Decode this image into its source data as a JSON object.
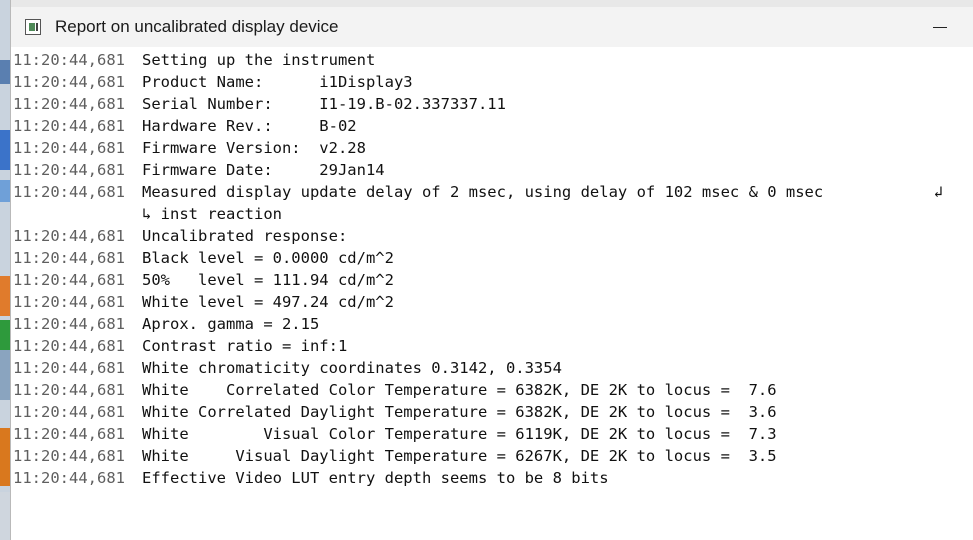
{
  "window": {
    "title": "Report on uncalibrated display device"
  },
  "log": [
    {
      "ts": "11:20:44,681",
      "msg": "Setting up the instrument"
    },
    {
      "ts": "11:20:44,681",
      "msg": "Product Name:      i1Display3"
    },
    {
      "ts": "11:20:44,681",
      "msg": "Serial Number:     I1-19.B-02.337337.11"
    },
    {
      "ts": "11:20:44,681",
      "msg": "Hardware Rev.:     B-02"
    },
    {
      "ts": "11:20:44,681",
      "msg": "Firmware Version:  v2.28"
    },
    {
      "ts": "11:20:44,681",
      "msg": "Firmware Date:     29Jan14"
    },
    {
      "ts": "11:20:44,681",
      "msg": "Measured display update delay of 2 msec, using delay of 102 msec & 0 msec",
      "wrap": "↲"
    },
    {
      "ts": "",
      "msg": "↳ inst reaction"
    },
    {
      "ts": "11:20:44,681",
      "msg": "Uncalibrated response:"
    },
    {
      "ts": "11:20:44,681",
      "msg": "Black level = 0.0000 cd/m^2"
    },
    {
      "ts": "11:20:44,681",
      "msg": "50%   level = 111.94 cd/m^2"
    },
    {
      "ts": "11:20:44,681",
      "msg": "White level = 497.24 cd/m^2"
    },
    {
      "ts": "11:20:44,681",
      "msg": "Aprox. gamma = 2.15"
    },
    {
      "ts": "11:20:44,681",
      "msg": "Contrast ratio = inf:1"
    },
    {
      "ts": "11:20:44,681",
      "msg": "White chromaticity coordinates 0.3142, 0.3354"
    },
    {
      "ts": "11:20:44,681",
      "msg": "White    Correlated Color Temperature = 6382K, DE 2K to locus =  7.6"
    },
    {
      "ts": "11:20:44,681",
      "msg": "White Correlated Daylight Temperature = 6382K, DE 2K to locus =  3.6"
    },
    {
      "ts": "11:20:44,681",
      "msg": "White        Visual Color Temperature = 6119K, DE 2K to locus =  7.3"
    },
    {
      "ts": "11:20:44,681",
      "msg": "White     Visual Daylight Temperature = 6267K, DE 2K to locus =  3.5"
    },
    {
      "ts": "11:20:44,681",
      "msg": "Effective Video LUT entry depth seems to be 8 bits"
    }
  ]
}
